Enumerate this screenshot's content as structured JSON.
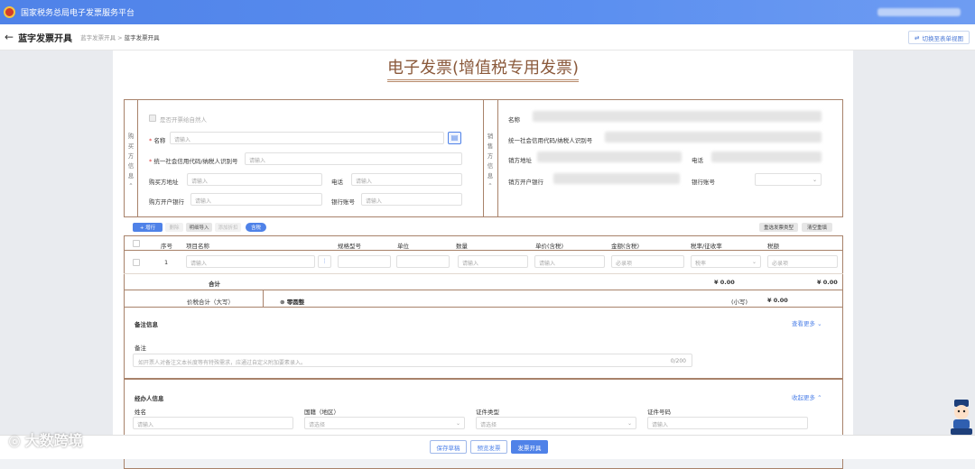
{
  "header": {
    "app_title": "国家税务总局电子发票服务平台"
  },
  "subheader": {
    "page_title": "蓝字发票开具",
    "crumb_parent": "蓝字发票开具",
    "crumb_sep": ">",
    "crumb_current": "蓝字发票开具",
    "switch_label": "切换至表单视图"
  },
  "invoice": {
    "title": "电子发票(增值税专用发票)"
  },
  "buyer": {
    "side_label": "购买方信息",
    "natural_person_label": "是否开票给自然人",
    "name_label": "名称",
    "name_placeholder": "请输入",
    "tax_id_label": "统一社会信用代码/纳税人识别号",
    "tax_id_placeholder": "请输入",
    "address_label": "购买方地址",
    "address_placeholder": "请输入",
    "phone_label": "电话",
    "phone_placeholder": "请输入",
    "bank_label": "购方开户银行",
    "bank_placeholder": "请输入",
    "account_label": "银行账号",
    "account_placeholder": "请输入"
  },
  "seller": {
    "side_label": "销售方信息",
    "name_label": "名称",
    "tax_id_label": "统一社会信用代码/纳税人识别号",
    "address_label": "销方地址",
    "phone_label": "电话",
    "bank_label": "销方开户银行",
    "account_label": "银行账号"
  },
  "toolbar": {
    "add": "+ 增行",
    "delete": "删除",
    "import": "明细导入",
    "add_discount": "添加折扣",
    "toggle": "含税",
    "select_type": "重选发票类型",
    "clear": "清空重填"
  },
  "table": {
    "headers": [
      "序号",
      "项目名称",
      "规格型号",
      "单位",
      "数量",
      "单价(含税)",
      "金额(含税)",
      "税率/征收率",
      "税额"
    ],
    "row": {
      "index": "1",
      "name_ph": "请输入",
      "qty_ph": "请输入",
      "price_ph": "请输入",
      "amount_ph": "必录项",
      "rate_ph": "税率",
      "tax_ph": "必录项"
    },
    "total_label": "合计",
    "total_amount": "¥ 0.00",
    "total_tax": "¥ 0.00",
    "grand_label": "价税合计（大写）",
    "grand_upper": "⊗ 零圆整",
    "grand_small_label": "(小写)",
    "grand_small": "¥ 0.00"
  },
  "remarks": {
    "section_title": "备注信息",
    "more": "查看更多",
    "label": "备注",
    "placeholder": "如开票人对备注文本长度等有特殊需求，应通过自定义附加要素录入。",
    "counter": "0/200"
  },
  "handler": {
    "section_title": "经办人信息",
    "collapse": "收起更多",
    "name_label": "姓名",
    "name_ph": "请输入",
    "country_label": "国籍（地区）",
    "country_ph": "请选择",
    "id_type_label": "证件类型",
    "id_type_ph": "请选择",
    "id_no_label": "证件号码",
    "id_no_ph": "请输入"
  },
  "footer": {
    "save": "保存草稿",
    "preview": "预览发票",
    "issue": "发票开具"
  },
  "watermark": "大数跨境",
  "colors": {
    "primary": "#4f82e8",
    "frame": "#a8826a",
    "title": "#8b5a3c"
  }
}
